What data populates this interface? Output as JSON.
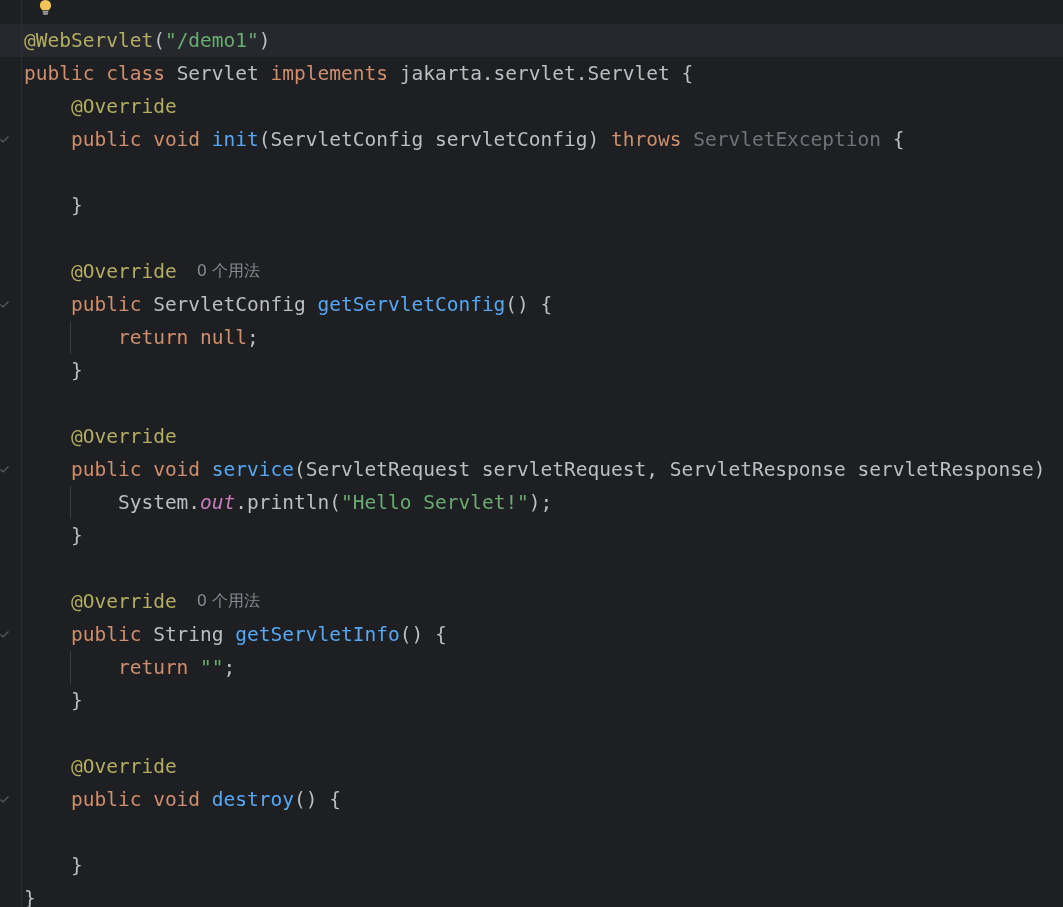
{
  "editor": {
    "lines": [
      {
        "kind": "blank",
        "intention_bulb": true
      },
      {
        "current": true,
        "tokens": [
          {
            "kind": "annotation",
            "text": "@WebServlet"
          },
          {
            "kind": "plain",
            "text": "("
          },
          {
            "kind": "string",
            "text": "\"/demo1\""
          },
          {
            "kind": "plain",
            "text": ")"
          }
        ]
      },
      {
        "tokens": [
          {
            "kind": "keyword",
            "text": "public class "
          },
          {
            "kind": "plain",
            "text": "Servlet "
          },
          {
            "kind": "keyword",
            "text": "implements "
          },
          {
            "kind": "plain",
            "text": "jakarta.servlet.Servlet {"
          }
        ]
      },
      {
        "tokens": [
          {
            "kind": "annotation",
            "text": "    @Override"
          }
        ]
      },
      {
        "override_mark": true,
        "tokens": [
          {
            "kind": "keyword",
            "text": "    public void "
          },
          {
            "kind": "method",
            "text": "init"
          },
          {
            "kind": "plain",
            "text": "(ServletConfig servletConfig) "
          },
          {
            "kind": "keyword",
            "text": "throws "
          },
          {
            "kind": "unused",
            "text": "ServletException"
          },
          {
            "kind": "plain",
            "text": " {"
          }
        ]
      },
      {
        "kind": "blank"
      },
      {
        "tokens": [
          {
            "kind": "plain",
            "text": "    }"
          }
        ]
      },
      {
        "kind": "blank"
      },
      {
        "hint": "0 个用法",
        "tokens": [
          {
            "kind": "annotation",
            "text": "    @Override"
          }
        ]
      },
      {
        "override_mark": true,
        "tokens": [
          {
            "kind": "keyword",
            "text": "    public "
          },
          {
            "kind": "plain",
            "text": "ServletConfig "
          },
          {
            "kind": "method",
            "text": "getServletConfig"
          },
          {
            "kind": "plain",
            "text": "() {"
          }
        ]
      },
      {
        "indent_guide": true,
        "tokens": [
          {
            "kind": "keyword",
            "text": "        return null"
          },
          {
            "kind": "plain",
            "text": ";"
          }
        ]
      },
      {
        "tokens": [
          {
            "kind": "plain",
            "text": "    }"
          }
        ]
      },
      {
        "kind": "blank"
      },
      {
        "tokens": [
          {
            "kind": "annotation",
            "text": "    @Override"
          }
        ]
      },
      {
        "override_mark": true,
        "tokens": [
          {
            "kind": "keyword",
            "text": "    public void "
          },
          {
            "kind": "method",
            "text": "service"
          },
          {
            "kind": "plain",
            "text": "(ServletRequest servletRequest, ServletResponse servletResponse)"
          }
        ]
      },
      {
        "indent_guide": true,
        "tokens": [
          {
            "kind": "plain",
            "text": "        System."
          },
          {
            "kind": "static",
            "text": "out"
          },
          {
            "kind": "plain",
            "text": ".println("
          },
          {
            "kind": "string",
            "text": "\"Hello Servlet!\""
          },
          {
            "kind": "plain",
            "text": ");"
          }
        ]
      },
      {
        "tokens": [
          {
            "kind": "plain",
            "text": "    }"
          }
        ]
      },
      {
        "kind": "blank"
      },
      {
        "hint": "0 个用法",
        "tokens": [
          {
            "kind": "annotation",
            "text": "    @Override"
          }
        ]
      },
      {
        "override_mark": true,
        "tokens": [
          {
            "kind": "keyword",
            "text": "    public "
          },
          {
            "kind": "plain",
            "text": "String "
          },
          {
            "kind": "method",
            "text": "getServletInfo"
          },
          {
            "kind": "plain",
            "text": "() {"
          }
        ]
      },
      {
        "indent_guide": true,
        "tokens": [
          {
            "kind": "keyword",
            "text": "        return "
          },
          {
            "kind": "string",
            "text": "\"\""
          },
          {
            "kind": "plain",
            "text": ";"
          }
        ]
      },
      {
        "tokens": [
          {
            "kind": "plain",
            "text": "    }"
          }
        ]
      },
      {
        "kind": "blank"
      },
      {
        "tokens": [
          {
            "kind": "annotation",
            "text": "    @Override"
          }
        ]
      },
      {
        "override_mark": true,
        "tokens": [
          {
            "kind": "keyword",
            "text": "    public void "
          },
          {
            "kind": "method",
            "text": "destroy"
          },
          {
            "kind": "plain",
            "text": "() {"
          }
        ]
      },
      {
        "kind": "blank"
      },
      {
        "tokens": [
          {
            "kind": "plain",
            "text": "    }"
          }
        ]
      },
      {
        "tokens": [
          {
            "kind": "plain",
            "text": "}"
          }
        ]
      }
    ]
  }
}
